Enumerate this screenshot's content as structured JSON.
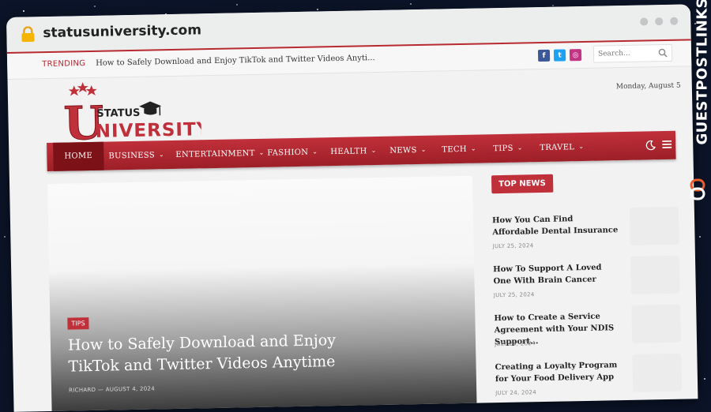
{
  "browser": {
    "url": "statusuniversity.com"
  },
  "topbar": {
    "trending_label": "TRENDING",
    "trending_text": "How to Safely Download and Enjoy TikTok and Twitter Videos Anyti...",
    "social": [
      {
        "icon": "facebook-icon",
        "glyph": "f",
        "color": "#3b5998"
      },
      {
        "icon": "twitter-icon",
        "glyph": "t",
        "color": "#1da1f2"
      },
      {
        "icon": "instagram-icon",
        "glyph": "◎",
        "color": "#c13584"
      }
    ],
    "search_placeholder": "Search..."
  },
  "header": {
    "logo_word_top": "STATUS",
    "logo_letter": "U",
    "logo_word_bottom": "NIVERSITY",
    "date": "Monday, August 5"
  },
  "nav": {
    "items": [
      {
        "label": "HOME",
        "active": true,
        "has_menu": false
      },
      {
        "label": "BUSINESS",
        "has_menu": true
      },
      {
        "label": "ENTERTAINMENT",
        "has_menu": true
      },
      {
        "label": "FASHION",
        "has_menu": true
      },
      {
        "label": "HEALTH",
        "has_menu": true
      },
      {
        "label": "NEWS",
        "has_menu": true
      },
      {
        "label": "TECH",
        "has_menu": true
      },
      {
        "label": "TIPS",
        "has_menu": true
      },
      {
        "label": "TRAVEL",
        "has_menu": true
      }
    ],
    "chevron": "⌄"
  },
  "hero": {
    "tag": "TIPS",
    "title": "How to Safely Download and Enjoy TikTok and Twitter Videos Anytime",
    "author": "RICHARD",
    "separator": "—",
    "date": "AUGUST 4, 2024"
  },
  "sidebar": {
    "heading": "TOP NEWS",
    "items": [
      {
        "title": "How You Can Find Affordable Dental Insurance",
        "date": "JULY 25, 2024"
      },
      {
        "title": "How To Support A Loved One With Brain Cancer",
        "date": "JULY 25, 2024"
      },
      {
        "title": "How to Create a Service Agreement with Your NDIS Support...",
        "date": "JULY 24, 2024"
      },
      {
        "title": "Creating a Loyalty Program for Your Food Delivery App",
        "date": "JULY 24, 2024"
      }
    ]
  },
  "watermark": {
    "text": "GUESTPOSTLINKS"
  },
  "colors": {
    "brand_red": "#c0303a",
    "dark_red": "#7d1118"
  }
}
